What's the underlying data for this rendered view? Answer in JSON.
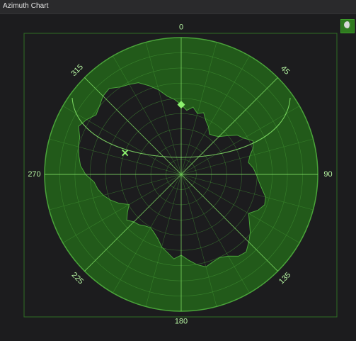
{
  "window": {
    "title": "Azimuth Chart"
  },
  "toolbar": {
    "theme_icon": "half-moon-icon"
  },
  "colors": {
    "background": "#1c1c1e",
    "ring_fill": "#225a1a",
    "grid": "#4aa33a",
    "accent": "#8cf06e",
    "label": "#b6f5a2",
    "obstruction_fill": "#1c1c1e"
  },
  "chart_data": {
    "type": "polar",
    "azimuth_labels": [
      "0",
      "45",
      "90",
      "135",
      "180",
      "225",
      "270",
      "315"
    ],
    "azimuth_degrees": [
      0,
      45,
      90,
      135,
      180,
      225,
      270,
      315
    ],
    "elevation_rings": 9,
    "spokes_every_degrees": 15,
    "markers": [
      {
        "symbol": "diamond",
        "azimuth": 0,
        "radius_fraction": 0.51
      },
      {
        "symbol": "x",
        "azimuth": 291,
        "radius_fraction": 0.44
      }
    ],
    "horizon_profile_fraction": [
      0.51,
      0.47,
      0.5,
      0.46,
      0.48,
      0.43,
      0.4,
      0.36,
      0.37,
      0.39,
      0.44,
      0.5,
      0.53,
      0.58,
      0.56,
      0.52,
      0.5,
      0.53,
      0.55,
      0.57,
      0.6,
      0.64,
      0.65,
      0.62,
      0.57,
      0.61,
      0.66,
      0.7,
      0.74,
      0.73,
      0.69,
      0.67,
      0.68,
      0.7,
      0.67,
      0.63,
      0.59,
      0.62,
      0.58,
      0.55,
      0.5,
      0.47,
      0.45,
      0.46,
      0.48,
      0.49,
      0.52,
      0.48,
      0.44,
      0.5,
      0.55,
      0.59,
      0.62,
      0.64,
      0.7,
      0.74,
      0.76,
      0.78,
      0.79,
      0.83,
      0.8,
      0.76,
      0.78,
      0.81,
      0.82,
      0.78,
      0.76,
      0.74,
      0.69,
      0.64,
      0.58,
      0.55
    ]
  }
}
